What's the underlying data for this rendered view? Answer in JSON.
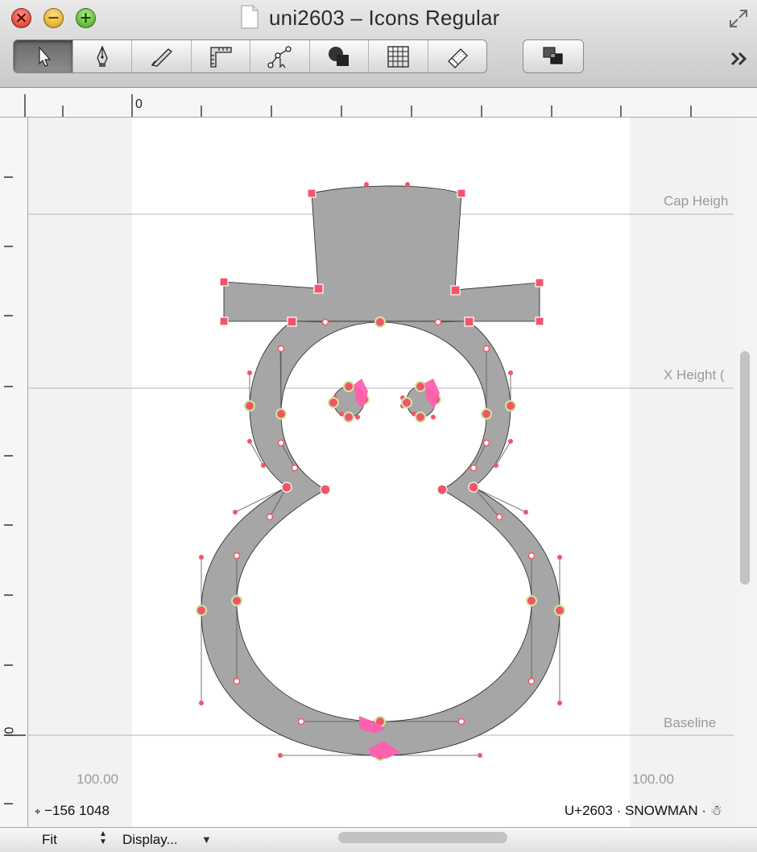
{
  "window": {
    "title": "uni2603 – Icons Regular",
    "controls": {
      "close": "×",
      "minimize": "−",
      "zoom": "+"
    }
  },
  "toolbar": {
    "tools": [
      {
        "name": "select-tool",
        "icon": "arrow-pointer-icon",
        "selected": true
      },
      {
        "name": "pen-tool",
        "icon": "pen-nib-icon"
      },
      {
        "name": "draw-tool",
        "icon": "pencil-knife-icon"
      },
      {
        "name": "measure-tool",
        "icon": "ruler-icon"
      },
      {
        "name": "node-tool",
        "icon": "nodes-icon"
      },
      {
        "name": "primitives-tool",
        "icon": "shapes-icon"
      },
      {
        "name": "grid-tool",
        "icon": "grid-icon"
      },
      {
        "name": "eraser-tool",
        "icon": "eraser-icon"
      }
    ],
    "layers_icon": "layers-icon",
    "overflow": "»"
  },
  "rulers": {
    "h_origin_label": "0",
    "v_origin_label": "0"
  },
  "canvas": {
    "guides": {
      "cap_height": "Cap Heigh",
      "x_height": "X Height (",
      "baseline": "Baseline"
    },
    "left_sidebearing": "100.00",
    "right_sidebearing": "100.00",
    "cursor_icon": "crosshair-icon",
    "cursor_coords": "−156 1048",
    "glyph_info": "U+2603 · SNOWMAN · ☃",
    "fill_color": "#a6a6a6",
    "point_color": "#f2556a",
    "direction_color": "#ff5fb0"
  },
  "bottom_bar": {
    "zoom": "Fit",
    "display": "Display..."
  }
}
